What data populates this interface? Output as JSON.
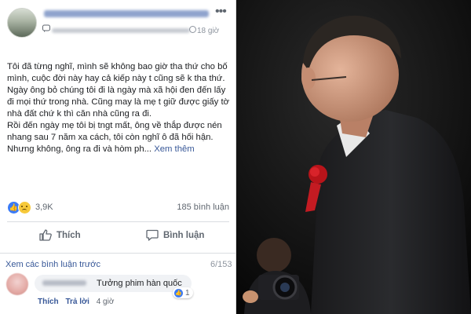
{
  "post": {
    "time": "18 giờ",
    "paragraphs": [
      "Tôi đã từng nghĩ, mình sẽ không bao giờ tha thứ cho bố mình, cuộc đời này hay cả kiếp này t cũng sẽ k tha thứ.",
      "Ngày ông bỏ chúng tôi đi là ngày mà xã hội đen đến lấy đi mọi thứ trong nhà. Cũng may là mẹ t giữ được giấy tờ nhà đất chứ k thì căn nhà cũng ra đi.",
      "Rồi đến ngày mẹ tôi bị tngt mất, ông về thắp được nén nhang sau 7 năm xa cách, tôi còn nghĩ ô đã hối hận. Nhưng không, ông ra đi và hòm ph..."
    ],
    "see_more": "Xem thêm",
    "reaction_count": "3,9K",
    "comment_count": "185 bình luận",
    "like_label": "Thích",
    "comment_label": "Bình luận"
  },
  "comments": {
    "view_previous": "Xem các bình luận trước",
    "page_count": "6/153",
    "items": [
      {
        "text": "Tưởng phim hàn quốc",
        "reactions": "1",
        "like": "Thích",
        "reply": "Trả lời",
        "time": "4 giờ"
      }
    ]
  },
  "colors": {
    "link": "#385898",
    "like_blue": "#3b7bf6",
    "muted": "#606770"
  }
}
